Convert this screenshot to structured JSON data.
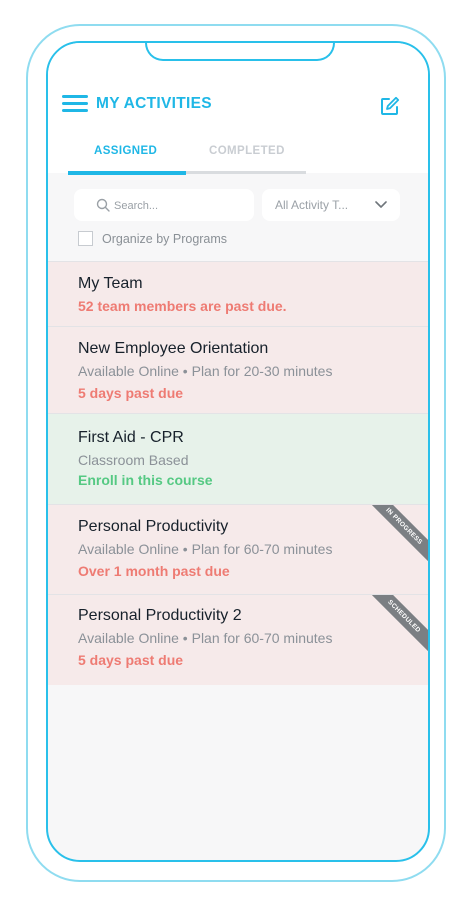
{
  "header": {
    "title": "MY ACTIVITIES"
  },
  "tabs": [
    {
      "label": "ASSIGNED",
      "active": true
    },
    {
      "label": "COMPLETED",
      "active": false
    }
  ],
  "filters": {
    "search_placeholder": "Search...",
    "activity_type": "All Activity T...",
    "organize_label": "Organize by Programs",
    "organize_checked": false
  },
  "activities": [
    {
      "title": "My Team",
      "status": "52 team members are past due."
    },
    {
      "title": "New Employee Orientation",
      "subtitle": "Available Online • Plan for 20-30 minutes",
      "status": "5 days past due"
    },
    {
      "title": "First Aid - CPR",
      "subtitle": "Classroom Based",
      "status": "Enroll in this course"
    },
    {
      "title": "Personal Productivity",
      "subtitle": "Available Online • Plan for 60-70 minutes",
      "status": "Over 1 month past due",
      "badge": "IN PROGRESS"
    },
    {
      "title": "Personal Productivity 2",
      "subtitle": "Available Online • Plan for 60-70 minutes",
      "status": "5 days past due",
      "badge": "SCHEDULED"
    }
  ],
  "colors": {
    "accent": "#1fb7e6",
    "past_due": "#ee7b73",
    "enroll": "#55c983",
    "row_red": "#f6eaea",
    "row_green": "#e7f2ea"
  },
  "icons": {
    "menu": "hamburger-menu-icon",
    "edit": "edit-note-icon",
    "search": "magnifier-icon",
    "dropdown": "chevron-down-icon"
  }
}
